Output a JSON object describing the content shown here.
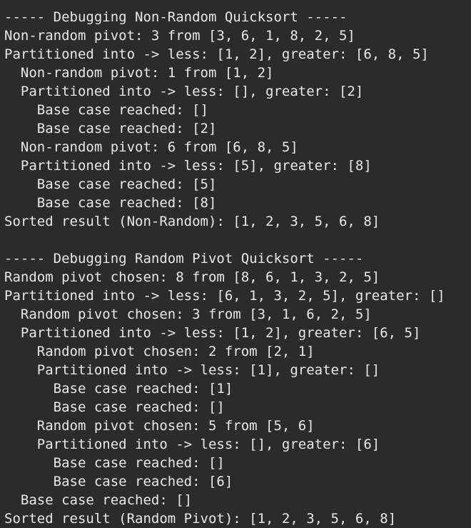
{
  "console": {
    "lines": [
      "----- Debugging Non-Random Quicksort -----",
      "Non-random pivot: 3 from [3, 6, 1, 8, 2, 5]",
      "Partitioned into -> less: [1, 2], greater: [6, 8, 5]",
      "  Non-random pivot: 1 from [1, 2]",
      "  Partitioned into -> less: [], greater: [2]",
      "    Base case reached: []",
      "    Base case reached: [2]",
      "  Non-random pivot: 6 from [6, 8, 5]",
      "  Partitioned into -> less: [5], greater: [8]",
      "    Base case reached: [5]",
      "    Base case reached: [8]",
      "Sorted result (Non-Random): [1, 2, 3, 5, 6, 8]",
      "",
      "----- Debugging Random Pivot Quicksort -----",
      "Random pivot chosen: 8 from [8, 6, 1, 3, 2, 5]",
      "Partitioned into -> less: [6, 1, 3, 2, 5], greater: []",
      "  Random pivot chosen: 3 from [3, 1, 6, 2, 5]",
      "  Partitioned into -> less: [1, 2], greater: [6, 5]",
      "    Random pivot chosen: 2 from [2, 1]",
      "    Partitioned into -> less: [1], greater: []",
      "      Base case reached: [1]",
      "      Base case reached: []",
      "    Random pivot chosen: 5 from [5, 6]",
      "    Partitioned into -> less: [], greater: [6]",
      "      Base case reached: []",
      "      Base case reached: [6]",
      "  Base case reached: []",
      "Sorted result (Random Pivot): [1, 2, 3, 5, 6, 8]"
    ]
  }
}
